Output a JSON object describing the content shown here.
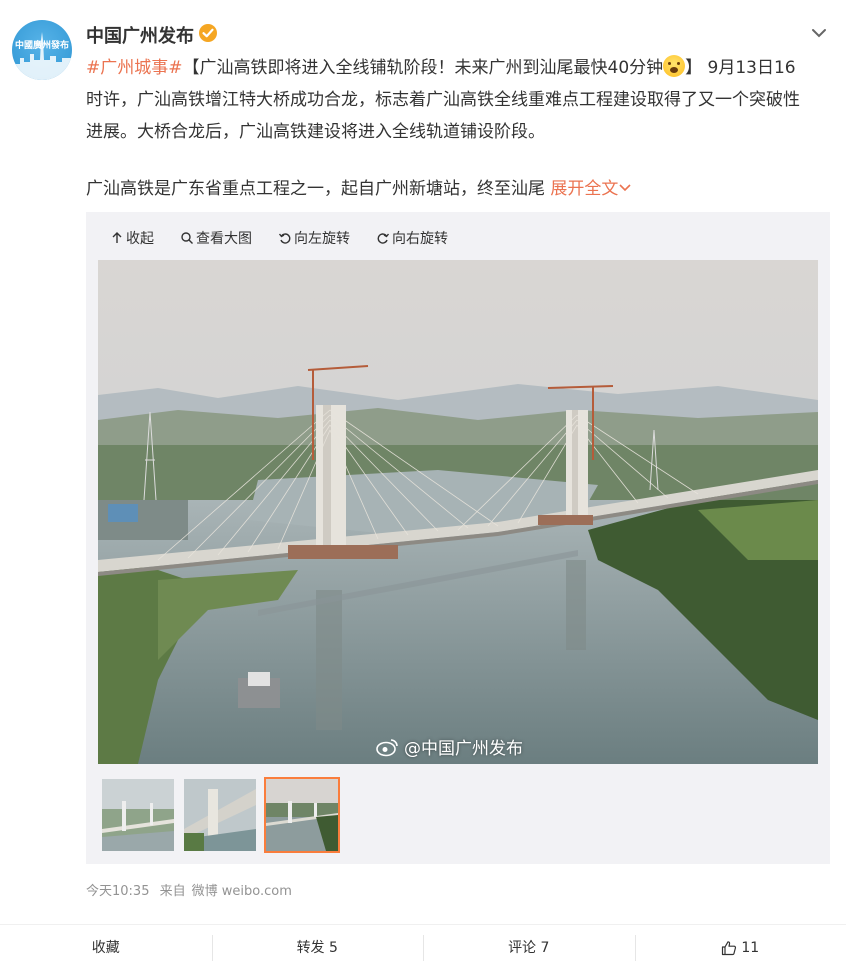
{
  "post": {
    "author": "中国广州发布",
    "avatar_text": "中國廣州發布",
    "hashtag": "#广州城事#",
    "headline": "【广汕高铁即将进入全线铺轨阶段！未来广州到汕尾最快40分钟",
    "headline_close": "】",
    "lead_inline": "9月13日16",
    "body_line2": "时许，广汕高铁增江特大桥成功合龙，标志着广汕高铁全线重难点工程建设取得了又一个突破性",
    "body_line3": "进展。大桥合龙后，广汕高铁建设将进入全线轨道铺设阶段。",
    "para2": "广汕高铁是广东省重点工程之一，起自广州新塘站，终至汕尾",
    "expand_label": "展开全文",
    "time": "今天10:35",
    "source_prefix": "来自",
    "source": "微博 weibo.com"
  },
  "media": {
    "toolbar": {
      "collapse": "收起",
      "view_large": "查看大图",
      "rotate_left": "向左旋转",
      "rotate_right": "向右旋转"
    },
    "watermark": "@中国广州发布",
    "thumbnails": [
      "thumb-1",
      "thumb-2",
      "thumb-3"
    ],
    "active_thumbnail": 3
  },
  "actions": {
    "favorite": "收藏",
    "repost": "转发 5",
    "comment": "评论 7",
    "like_count": "11"
  },
  "colors": {
    "accent": "#eb7350",
    "thumb_active_border": "#fa7d3c",
    "panel_bg": "#f2f2f5",
    "verified": "#f5a623"
  }
}
